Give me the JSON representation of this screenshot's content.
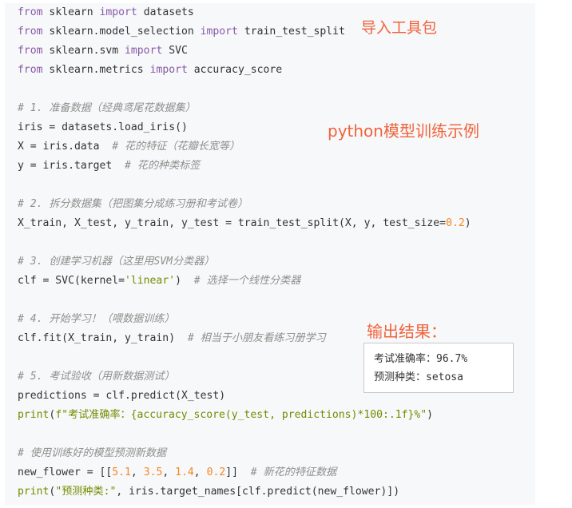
{
  "code_lines": [
    "from sklearn import datasets",
    "from sklearn.model_selection import train_test_split",
    "from sklearn.svm import SVC",
    "from sklearn.metrics import accuracy_score",
    "",
    "# 1. 准备数据（经典鸢尾花数据集）",
    "iris = datasets.load_iris()",
    "X = iris.data  # 花的特征（花瓣长宽等）",
    "y = iris.target  # 花的种类标签",
    "",
    "# 2. 拆分数据集（把图集分成练习册和考试卷）",
    "X_train, X_test, y_train, y_test = train_test_split(X, y, test_size=0.2)",
    "",
    "# 3. 创建学习机器（这里用SVM分类器）",
    "clf = SVC(kernel='linear')  # 选择一个线性分类器",
    "",
    "# 4. 开始学习！（喂数据训练）",
    "clf.fit(X_train, y_train)  # 相当于小朋友看练习册学习",
    "",
    "# 5. 考试验收（用新数据测试）",
    "predictions = clf.predict(X_test)",
    "print(f\"考试准确率：{accuracy_score(y_test, predictions)*100:.1f}%\")",
    "",
    "# 使用训练好的模型预测新数据",
    "new_flower = [[5.1, 3.5, 1.4, 0.2]]  # 新花的特征数据",
    "print(\"预测种类:\", iris.target_names[clf.predict(new_flower)])"
  ],
  "annotations": {
    "import_label": "导入工具包",
    "title_label": "python模型训练示例",
    "output_label": "输出结果："
  },
  "output": {
    "line1": "考试准确率：96.7%",
    "line2": "预测种类：setosa"
  },
  "colors": {
    "keyword": "#8959a8",
    "comment": "#8e908c",
    "number": "#f5871f",
    "builtin": "#718c00",
    "annotation": "#f0643c"
  }
}
